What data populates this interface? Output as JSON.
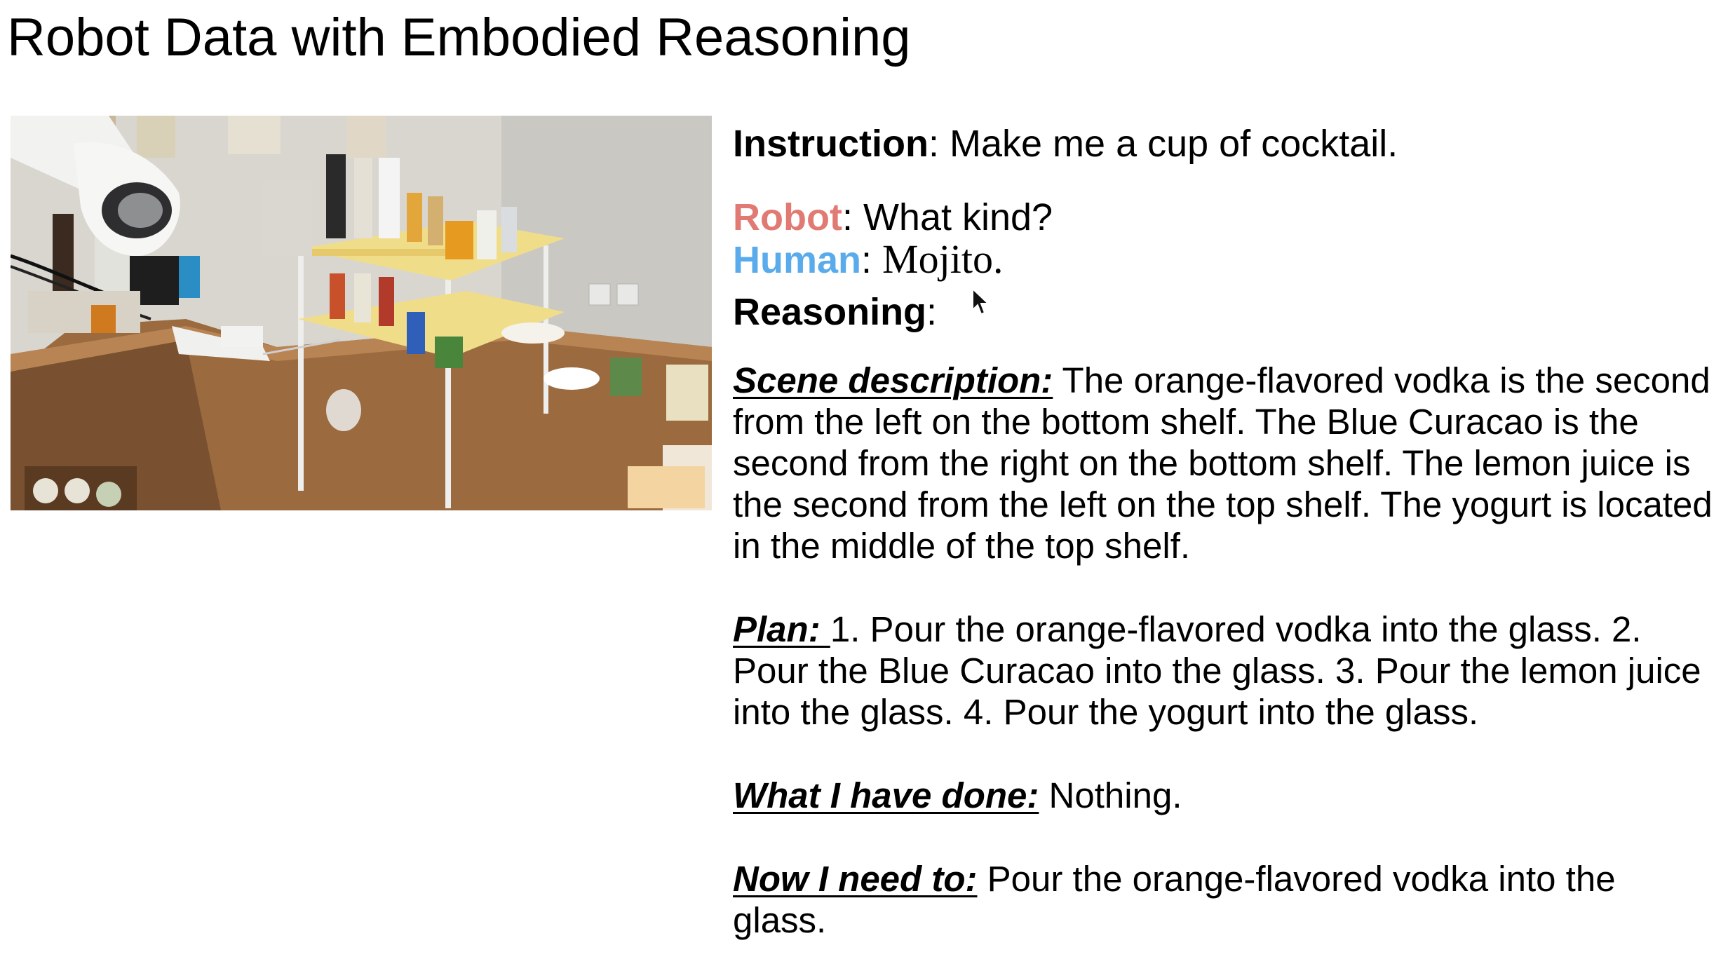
{
  "slide": {
    "title": "Robot Data with Embodied Reasoning"
  },
  "colors": {
    "robot": "#e07a72",
    "human": "#5aabeb",
    "text": "#000000",
    "background": "#ffffff"
  },
  "dialog": {
    "instruction_label": "Instruction",
    "instruction_text": ": Make me a cup of cocktail.",
    "robot_label": "Robot",
    "robot_text": ": What kind?",
    "human_label": "Human",
    "human_sep": ": ",
    "human_text": "Mojito.",
    "reasoning_label": "Reasoning",
    "reasoning_sep": ":"
  },
  "reasoning": {
    "scene_label": "Scene description:",
    "scene_text": " The orange-flavored vodka is the second from the left on the bottom shelf. The Blue Curacao is the second from the right on the bottom shelf. The lemon juice is the second from the left on the top shelf. The yogurt is located in the middle of the top shelf.",
    "plan_label": "Plan: ",
    "plan_text": "1. Pour the orange-flavored vodka into the glass. 2. Pour the Blue Curacao into the glass. 3. Pour the lemon juice into the glass. 4. Pour the yogurt into the glass.",
    "done_label": "What I have done:",
    "done_text": " Nothing.",
    "next_label": "Now I need to:",
    "next_text": " Pour the orange-flavored vodka into the glass."
  },
  "photo": {
    "icon": "robot-kitchen-photo"
  }
}
